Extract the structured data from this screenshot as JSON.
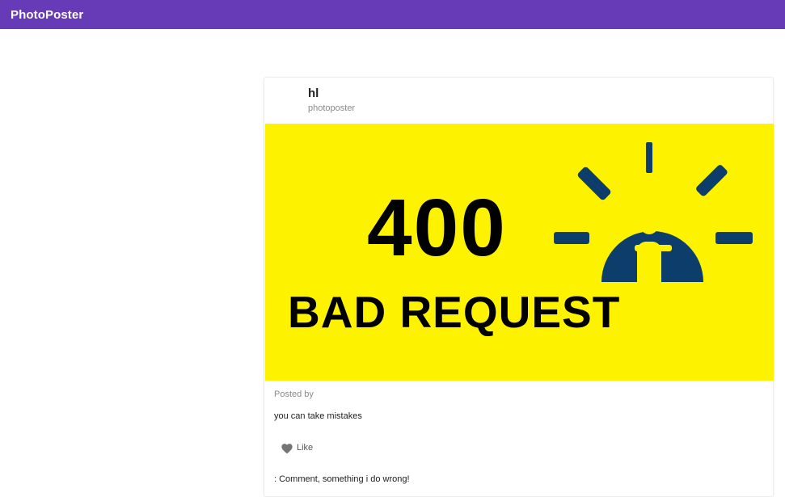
{
  "app": {
    "title": "PhotoPoster"
  },
  "post": {
    "title": "hl",
    "subtitle": "photoposter",
    "image": {
      "big_text": "400",
      "sub_text": "BAD REQUEST",
      "background_color": "#fdf300",
      "icon_color": "#0d3d6b",
      "icon": "lightbulb-person-icon"
    },
    "posted_by_label": "Posted by",
    "text": "you can take mistakes",
    "like_label": "Like",
    "comment": ": Comment, something i do wrong!"
  },
  "colors": {
    "appbar": "#673ab7",
    "like_icon": "#757575"
  }
}
